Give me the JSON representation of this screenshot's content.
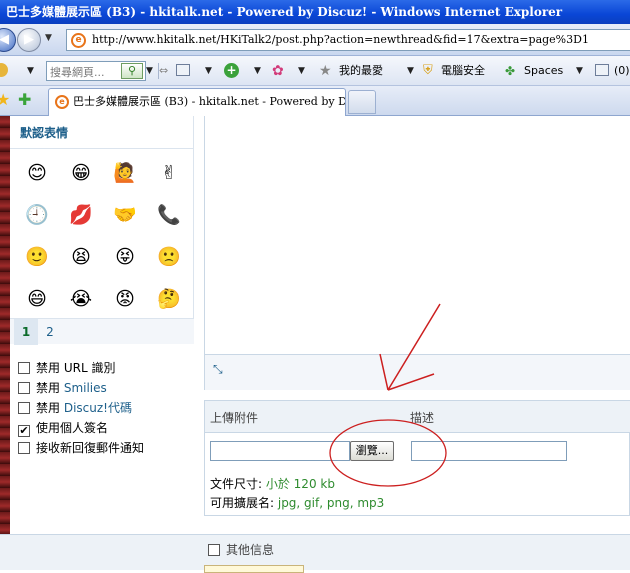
{
  "window": {
    "title": "巴士多媒體展示區 (B3) - hkitalk.net - Powered by Discuz! - Windows Internet Explorer"
  },
  "address_bar": {
    "url": "http://www.hkitalk.net/HKiTalk2/post.php?action=newthread&fid=17&extra=page%3D1"
  },
  "links_toolbar": {
    "search_placeholder": "搜尋網頁...",
    "favorites_label": "我的最愛",
    "security_label": "電腦安全",
    "spaces_label": "Spaces",
    "mail_count": "(0)"
  },
  "tabs": [
    {
      "label": "巴士多媒體展示區 (B3) - hkitalk.net - Powered by Di..."
    }
  ],
  "smilies_panel": {
    "title": "默認表情",
    "emojis": [
      "😊",
      "😁",
      "🙋",
      "✌",
      "🕘",
      "💋",
      "🤝",
      "📞",
      "🙂",
      "😫",
      "😝",
      "🙁",
      "😄",
      "😭",
      "😡",
      "🤔"
    ],
    "pages": [
      "1",
      "2"
    ],
    "active_page": "1"
  },
  "options": [
    {
      "prefix": "禁用 ",
      "highlight": "URL 識別",
      "highlight_blue": false,
      "checked": false
    },
    {
      "prefix": "禁用 ",
      "highlight": "Smilies",
      "highlight_blue": true,
      "checked": false
    },
    {
      "prefix": "禁用 ",
      "highlight": "Discuz!代碼",
      "highlight_blue": true,
      "checked": false
    },
    {
      "prefix": "使用個人簽名",
      "highlight": "",
      "highlight_blue": false,
      "checked": true
    },
    {
      "prefix": "接收新回復郵件通知",
      "highlight": "",
      "highlight_blue": false,
      "checked": false
    }
  ],
  "attachment": {
    "upload_header": "上傳附件",
    "description_header": "描述",
    "browse_label": "瀏覽...",
    "filesize_label": "文件尺寸: ",
    "filesize_value": "小於 120 kb",
    "extensions_label": "可用擴展名: ",
    "extensions_value": "jpg, gif, png, mp3"
  },
  "other_info": {
    "label": "其他信息"
  },
  "colors": {
    "title_bar": "#0a46d6",
    "link_blue": "#1d5f8a",
    "value_green": "#2e8b2e",
    "annotation_red": "#cc1f1f"
  }
}
